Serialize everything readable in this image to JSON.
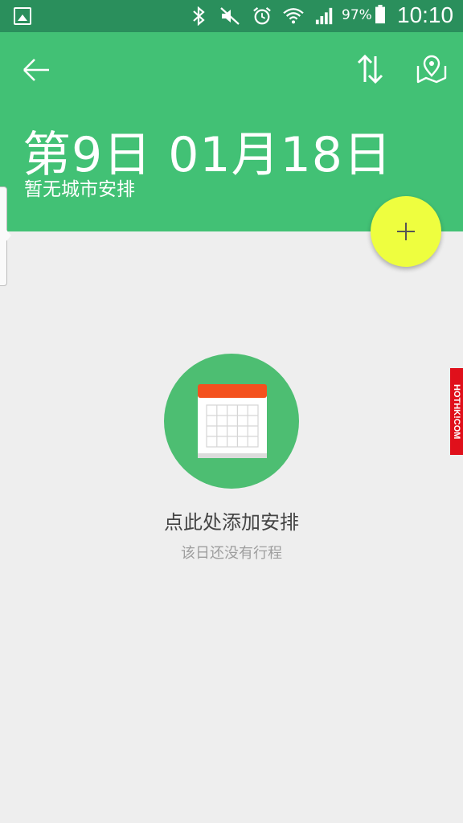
{
  "status_bar": {
    "battery_percent": "97%",
    "time": "10:10",
    "icons": [
      "gallery-icon",
      "bluetooth-icon",
      "mute-icon",
      "alarm-icon",
      "wifi-icon",
      "signal-icon",
      "battery-icon"
    ]
  },
  "header": {
    "title": "第9日 01月18日",
    "subtitle": "暂无城市安排",
    "background_color": "#42c175",
    "actions": [
      "back-arrow-icon",
      "sort-icon",
      "map-pin-icon"
    ]
  },
  "fab": {
    "icon": "plus-icon",
    "color": "#eefe3f"
  },
  "empty_state": {
    "title": "点此处添加安排",
    "subtitle": "该日还没有行程",
    "icon": "calendar-icon",
    "icon_accent": "#f4511e"
  },
  "watermark": {
    "text": "HOTHK!COM"
  }
}
